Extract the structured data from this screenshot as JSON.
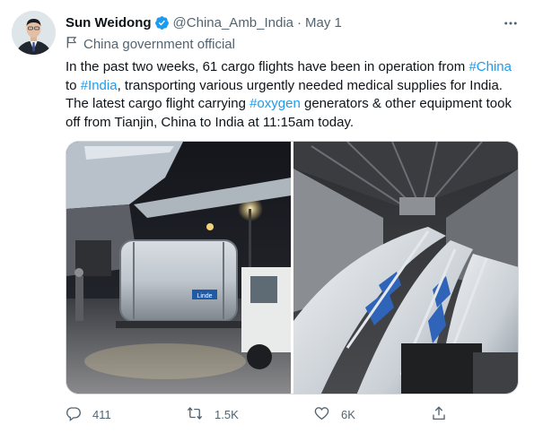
{
  "author": {
    "name": "Sun Weidong",
    "handle": "@China_Amb_India",
    "date": "May 1",
    "label": "China government official"
  },
  "tweet": {
    "segments": [
      {
        "text": "In the past two weeks, 61 cargo flights have been in operation from ",
        "link": false
      },
      {
        "text": "#China",
        "link": true
      },
      {
        "text": " to ",
        "link": false
      },
      {
        "text": "#India",
        "link": true
      },
      {
        "text": ", transporting various urgently needed medical supplies for India. The latest cargo flight carrying ",
        "link": false
      },
      {
        "text": "#oxygen",
        "link": true
      },
      {
        "text": " generators & other equipment took off from Tianjin, China to India at 11:15am today.",
        "link": false
      }
    ]
  },
  "media": {
    "left_tank_text": "Linde",
    "left_tank_placard": "OXYGEN"
  },
  "stats": {
    "replies": "411",
    "retweets": "1.5K",
    "likes": "6K"
  },
  "icons": {
    "verified": "verified-badge-icon",
    "more": "more-options-icon",
    "label": "flag-icon",
    "reply": "reply-icon",
    "retweet": "retweet-icon",
    "like": "heart-icon",
    "share": "share-icon"
  },
  "colors": {
    "link": "#1d9bf0",
    "secondary_text": "#536471",
    "primary_text": "#0f1419",
    "verified": "#1d9bf0"
  }
}
